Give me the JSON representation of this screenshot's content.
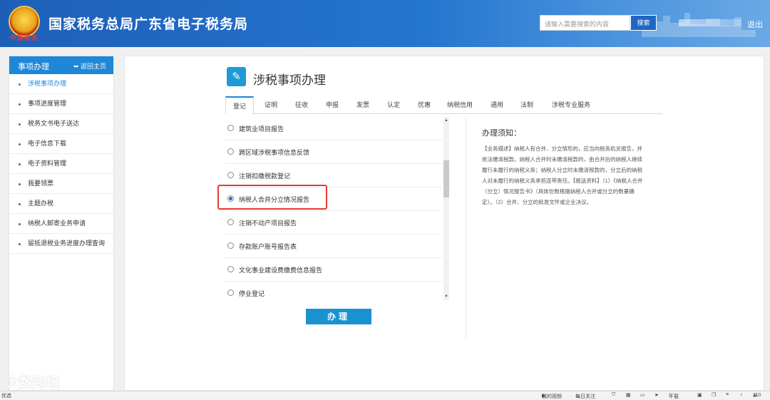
{
  "header": {
    "emblem_text": "中国税务",
    "site_title": "国家税务总局广东省电子税务局",
    "search_placeholder": "请输入需要搜索的内容",
    "search_button": "搜索",
    "logout": "退出"
  },
  "sidebar": {
    "title": "事项办理",
    "home_link": "返回主页",
    "items": [
      {
        "label": "涉税事项办理",
        "active": true
      },
      {
        "label": "事项进度管理"
      },
      {
        "label": "税务文书电子送达"
      },
      {
        "label": "电子信息下载"
      },
      {
        "label": "电子资料管理"
      },
      {
        "label": "我要领票"
      },
      {
        "label": "主题办税"
      },
      {
        "label": "纳税人邮寄业务申请"
      },
      {
        "label": "留抵退税业务进度办理查询"
      }
    ]
  },
  "main": {
    "title": "涉税事项办理",
    "tabs": [
      "登记",
      "证明",
      "征收",
      "申报",
      "发票",
      "认定",
      "优惠",
      "纳税信用",
      "通用",
      "法制",
      "涉税专业服务"
    ],
    "active_tab": 0,
    "options": [
      {
        "label": "建筑业项目报告"
      },
      {
        "label": "跨区域涉税事项信息反馈"
      },
      {
        "label": "注销扣缴税款登记"
      },
      {
        "label": "纳税人合并分立情况报告",
        "checked": true
      },
      {
        "label": "注销不动产项目报告"
      },
      {
        "label": "存款账户账号报告表"
      },
      {
        "label": "文化事业建设费缴费信息报告"
      },
      {
        "label": "停业登记"
      }
    ],
    "submit_button": "办理",
    "notice_title": "办理须知：",
    "notice_text": "【业务描述】纳税人有合并、分立情形的，应当向税务机关报告，并依法缴清税款。纳税人合并时未缴清税款的，由合并后的纳税人继续履行未履行的纳税义务；纳税人分立时未缴清税款的，分立后的纳税人对未履行的纳税义务承担连带责任。【报送资料】（1）《纳税人合并（分立）情况报告书》（具体份数根据纳税人合并或分立的数量确定）。（2）合并、分立的批准文件或企业决议。"
  },
  "watermark": "大数跨境",
  "statusbar": {
    "left": "优选",
    "video": "我的视频",
    "follow": "每日关注",
    "download": "下载",
    "zoom": "110"
  },
  "colors": {
    "header_blue": "#2475cf",
    "accent_blue": "#1e87d8",
    "highlight_red": "#e53935",
    "button_blue": "#1b92d0"
  }
}
